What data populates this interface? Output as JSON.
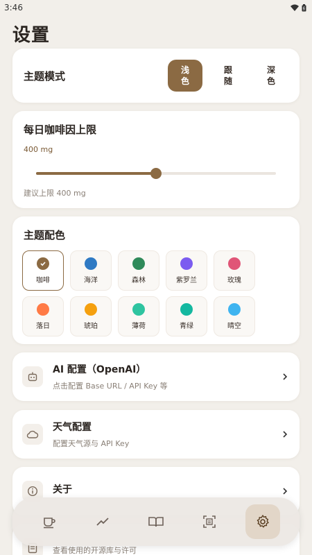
{
  "status_bar": {
    "time": "3:46"
  },
  "page": {
    "title": "设置"
  },
  "theme_mode": {
    "label": "主题模式",
    "options": [
      "浅\n色",
      "跟\n随",
      "深\n色"
    ],
    "selected_index": 0
  },
  "caffeine": {
    "title": "每日咖啡因上限",
    "value": "400 mg",
    "hint": "建议上限 400 mg",
    "slider_fraction": 0.5
  },
  "palette": {
    "title": "主题配色",
    "selected_index": 0,
    "items": [
      {
        "name": "咖啡",
        "color": "#8b6a43"
      },
      {
        "name": "海洋",
        "color": "#2f7ac4"
      },
      {
        "name": "森林",
        "color": "#2f8a5a"
      },
      {
        "name": "紫罗兰",
        "color": "#7b5cf0"
      },
      {
        "name": "玫瑰",
        "color": "#e05577"
      },
      {
        "name": "落日",
        "color": "#ff7a45"
      },
      {
        "name": "琥珀",
        "color": "#f5a00f"
      },
      {
        "name": "薄荷",
        "color": "#2ec4a0"
      },
      {
        "name": "青绿",
        "color": "#14b8a0"
      },
      {
        "name": "晴空",
        "color": "#3fb4f0"
      }
    ]
  },
  "rows": {
    "ai": {
      "title": "AI 配置（OpenAI）",
      "subtitle": "点击配置 Base URL / API Key 等",
      "icon": "robot-icon"
    },
    "weather": {
      "title": "天气配置",
      "subtitle": "配置天气源与 API Key",
      "icon": "cloud-icon"
    },
    "about": {
      "title": "关于",
      "subtitle": "",
      "icon": "info-icon"
    },
    "license": {
      "title": "",
      "subtitle": "查看使用的开源库与许可",
      "icon": "document-icon"
    }
  },
  "bottom_nav": {
    "items": [
      "coffee-cup-icon",
      "trend-chart-icon",
      "book-icon",
      "scan-icon",
      "settings-icon"
    ],
    "active_index": 4
  },
  "colors": {
    "accent": "#8b6a43",
    "background": "#f2efea",
    "active_nav_bg": "#e2d6c8"
  }
}
